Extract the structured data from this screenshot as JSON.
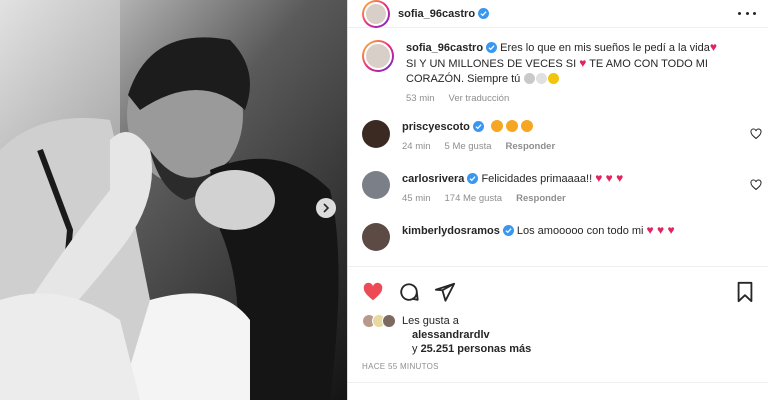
{
  "post": {
    "username": "sofia_96castro"
  },
  "caption": {
    "username": "sofia_96castro",
    "text_1": "Eres lo que en mis sueños le pedí a la vida",
    "text_2": "SI Y UN MILLONES DE VECES SI",
    "text_3": "TE AMO CON TODO MI CORAZÓN. Siempre tú",
    "time": "53 min",
    "translate": "Ver traducción"
  },
  "comments": [
    {
      "username": "priscyescoto",
      "text": "",
      "time": "24 min",
      "likes": "5 Me gusta",
      "reply": "Responder"
    },
    {
      "username": "carlosrivera",
      "text": "Felicidades primaaaa!!",
      "time": "45 min",
      "likes": "174 Me gusta",
      "reply": "Responder"
    },
    {
      "username": "kimberlydosramos",
      "text": "Los amooooo con todo mi",
      "time": "",
      "likes": "",
      "reply": ""
    }
  ],
  "likes": {
    "prefix": "Les gusta a",
    "user": "alessandrardlv",
    "connector": "y",
    "count": "25.251 personas más"
  },
  "timestamp": "HACE 55 MINUTOS",
  "colors": {
    "like_red": "#ed4956",
    "verified_blue": "#3897f0",
    "muted": "#8e8e8e"
  },
  "icons": [
    "more-icon",
    "heart-icon",
    "comment-icon",
    "share-icon",
    "bookmark-icon",
    "verified-icon",
    "chevron-right-icon"
  ]
}
